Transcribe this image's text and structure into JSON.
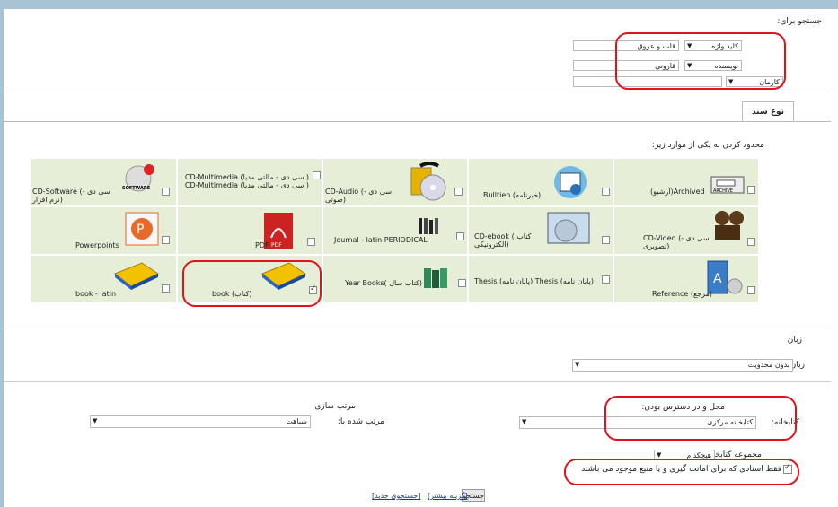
{
  "search_for": {
    "title": "جستجو برای:",
    "rows": [
      {
        "field": "کلید واژه",
        "value": "قلب و عروق",
        "term2": ""
      },
      {
        "field": "نویسنده",
        "value": "قاروني",
        "term2": ""
      },
      {
        "field": "کارمان",
        "value": "",
        "term2": ""
      }
    ]
  },
  "doc_type": {
    "tab": "نوع سند",
    "limit_label": "محدود کردن به یکی از موارد زیر:",
    "items": [
      {
        "label": "(آرشیو)Archived",
        "checked": false,
        "icon": "archive-icon"
      },
      {
        "label": "Bulltien (خبرنامه)",
        "checked": false,
        "icon": "newsletter-icon"
      },
      {
        "label": "CD-Audio (سی دی - صوتی)",
        "checked": false,
        "icon": "cd-audio-icon"
      },
      {
        "label": "CD-Multimedia (سی دی - مالتی مدیا ) CD-Multimedia (سی دی - مالتی مدیا )",
        "checked": false,
        "icon": "multimedia-icon"
      },
      {
        "label": "CD-Software (سی دی - نرم افزار)",
        "checked": false,
        "icon": "software-icon"
      },
      {
        "label": "CD-Video (سی دی - تصویری)",
        "checked": false,
        "icon": "video-camera-icon"
      },
      {
        "label": "CD-ebook ( کتاب الکترونیکی)",
        "checked": false,
        "icon": "ebook-icon"
      },
      {
        "label": "Journal - latin  PERIODICAL",
        "checked": false,
        "icon": "journal-icon"
      },
      {
        "label": "PDF",
        "checked": false,
        "icon": "pdf-icon"
      },
      {
        "label": "Powerpoints",
        "checked": false,
        "icon": "powerpoint-icon"
      },
      {
        "label": "Reference (مرجع)",
        "checked": false,
        "icon": "reference-icon"
      },
      {
        "label": "Thesis (پایان نامه) Thesis (پایان نامه)",
        "checked": false,
        "icon": "thesis-icon"
      },
      {
        "label": "Year Books( کتاب سال)",
        "checked": false,
        "icon": "yearbook-icon"
      },
      {
        "label": "book (کتاب)",
        "checked": true,
        "icon": "book-icon"
      },
      {
        "label": "book - latin",
        "checked": false,
        "icon": "book-latin-icon"
      }
    ]
  },
  "language": {
    "section": "زبان",
    "label": "زبان:",
    "value": "بدون محدویت"
  },
  "location": {
    "section": "محل و در دسترس بودن:",
    "library_label": "کتابخانه:",
    "library_value": "کتابخانه مرکزی",
    "collection_label": "مجموعه کتابخانه ها",
    "collection_value": "هیچکدام",
    "available_label": "فقط اسنادی که برای امانت گیری و یا منبع موجود می باشند",
    "available_checked": true
  },
  "sort": {
    "section": "مرتب سازی",
    "label": "مرتب شده با:",
    "value": "شباهت"
  },
  "actions": {
    "search": "جستجو",
    "more_options": "[گزینه بیشتر]",
    "new_search": "[جستجوی جدید]"
  },
  "colors": {
    "highlight": "#e0121a",
    "cell_bg": "#e7eed8",
    "frame": "#a8c4d4"
  }
}
